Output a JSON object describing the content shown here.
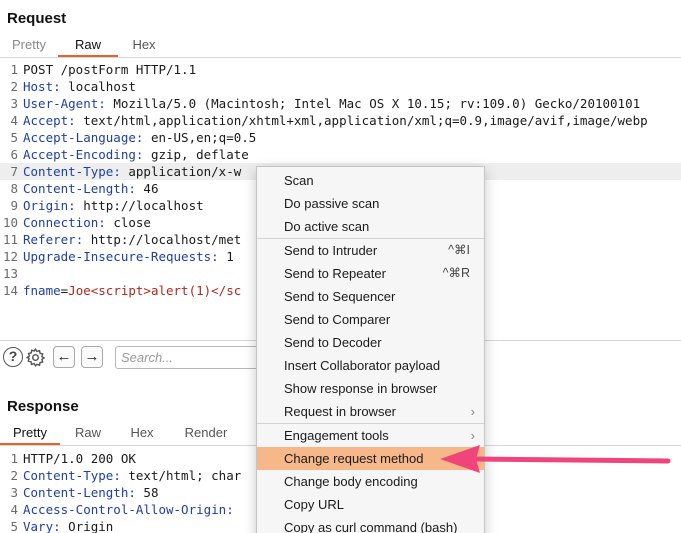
{
  "request": {
    "title": "Request",
    "tabs": [
      "Pretty",
      "Raw",
      "Hex"
    ],
    "active_tab": "Raw",
    "lines": [
      {
        "num": "1",
        "text": "POST /postForm HTTP/1.1"
      },
      {
        "num": "2",
        "name": "Host",
        "value": " localhost"
      },
      {
        "num": "3",
        "name": "User-Agent",
        "value": " Mozilla/5.0 (Macintosh; Intel Mac OS X 10.15; rv:109.0) Gecko/20100101"
      },
      {
        "num": "4",
        "name": "Accept",
        "value": " text/html,application/xhtml+xml,application/xml;q=0.9,image/avif,image/webp"
      },
      {
        "num": "5",
        "name": "Accept-Language",
        "value": " en-US,en;q=0.5"
      },
      {
        "num": "6",
        "name": "Accept-Encoding",
        "value": " gzip, deflate"
      },
      {
        "num": "7",
        "name": "Content-Type",
        "value": " application/x-w"
      },
      {
        "num": "8",
        "name": "Content-Length",
        "value": " 46"
      },
      {
        "num": "9",
        "name": "Origin",
        "value": " http://localhost"
      },
      {
        "num": "10",
        "name": "Connection",
        "value": " close"
      },
      {
        "num": "11",
        "name": "Referer",
        "value": " http://localhost/met"
      },
      {
        "num": "12",
        "name": "Upgrade-Insecure-Requests",
        "value": " 1"
      },
      {
        "num": "13",
        "text": ""
      },
      {
        "num": "14",
        "param": "fname",
        "param_value": "Joe<script>alert(1)</sc"
      }
    ]
  },
  "toolbar": {
    "help_icon": "question-circle-icon",
    "settings_icon": "gear-icon",
    "back_icon": "arrow-left-icon",
    "forward_icon": "arrow-right-icon",
    "search_placeholder": "Search..."
  },
  "response": {
    "title": "Response",
    "tabs": [
      "Pretty",
      "Raw",
      "Hex",
      "Render"
    ],
    "active_tab": "Pretty",
    "lines": [
      {
        "num": "1",
        "text": "HTTP/1.0 200 OK"
      },
      {
        "num": "2",
        "name": "Content-Type",
        "value": " text/html; char"
      },
      {
        "num": "3",
        "name": "Content-Length",
        "value": " 58"
      },
      {
        "num": "4",
        "name": "Access-Control-Allow-Origin",
        "value": ""
      },
      {
        "num": "5",
        "name": "Vary",
        "value": " Origin"
      }
    ]
  },
  "context_menu": {
    "items": [
      {
        "label": "Scan"
      },
      {
        "label": "Do passive scan"
      },
      {
        "label": "Do active scan",
        "separator_after": true
      },
      {
        "label": "Send to Intruder",
        "shortcut": "^⌘I"
      },
      {
        "label": "Send to Repeater",
        "shortcut": "^⌘R"
      },
      {
        "label": "Send to Sequencer"
      },
      {
        "label": "Send to Comparer"
      },
      {
        "label": "Send to Decoder"
      },
      {
        "label": "Insert Collaborator payload"
      },
      {
        "label": "Show response in browser"
      },
      {
        "label": "Request in browser",
        "submenu": true,
        "separator_after": true
      },
      {
        "label": "Engagement tools",
        "submenu": true
      },
      {
        "label": "Change request method",
        "selected": true
      },
      {
        "label": "Change body encoding"
      },
      {
        "label": "Copy URL"
      },
      {
        "label": "Copy as curl command (bash)"
      }
    ]
  },
  "colors": {
    "accent": "#e8612c",
    "menu_highlight": "#f7b889",
    "arrow": "#f0457a",
    "header_name": "#1f3fa6",
    "param_value": "#b3261e"
  }
}
